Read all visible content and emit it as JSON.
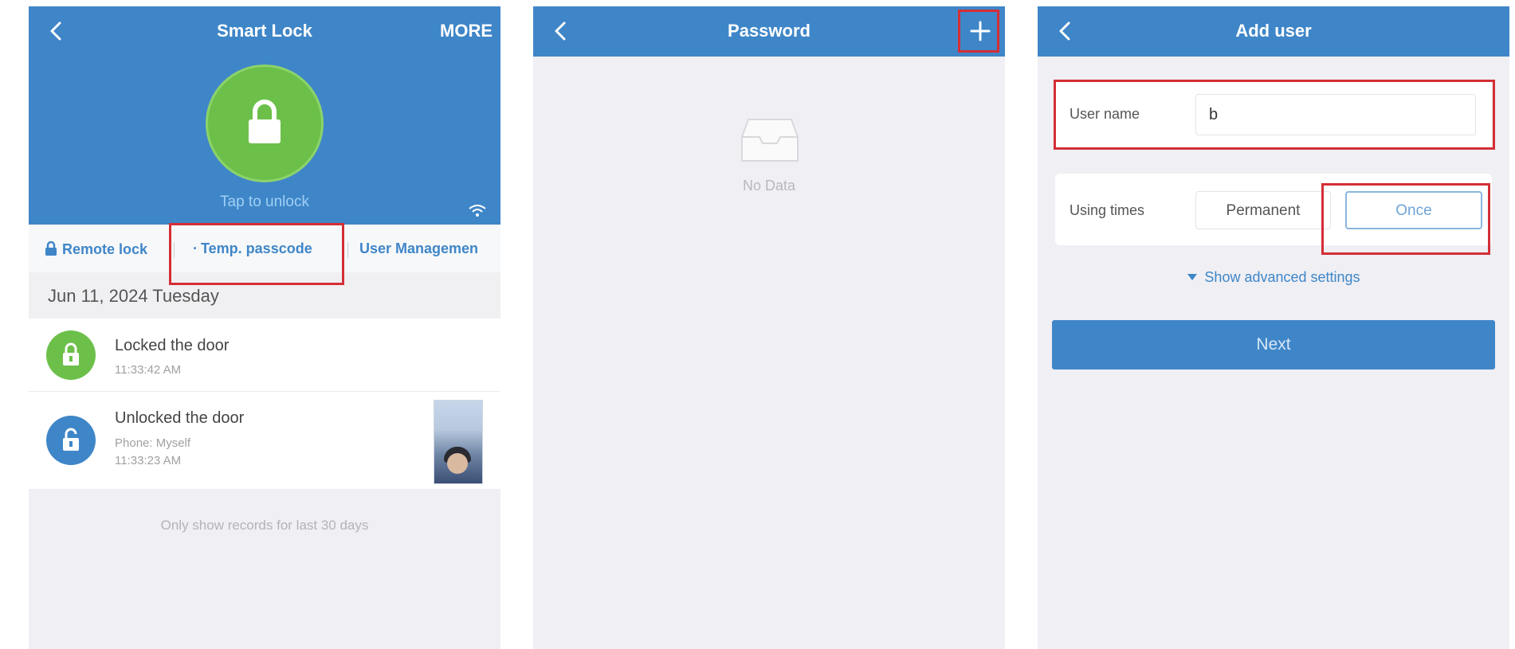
{
  "screens": {
    "smart_lock": {
      "title": "Smart Lock",
      "more_label": "MORE",
      "tap_to_unlock": "Tap to unlock",
      "actions": {
        "remote_lock": "Remote lock",
        "temp_passcode": "Temp. passcode",
        "user_management": "User Managemen"
      },
      "date_header": "Jun 11, 2024 Tuesday",
      "records": [
        {
          "title": "Locked the door",
          "time": "11:33:42 AM",
          "status": "locked",
          "color": "#6cc04a"
        },
        {
          "title": "Unlocked the door",
          "source": "Phone: Myself",
          "time": "11:33:23 AM",
          "status": "unlocked",
          "color": "#3f86c8"
        }
      ],
      "footnote": "Only show records for last 30 days"
    },
    "password": {
      "title": "Password",
      "empty_text": "No Data"
    },
    "add_user": {
      "title": "Add user",
      "username_label": "User name",
      "username_value": "b",
      "using_times_label": "Using times",
      "option_permanent": "Permanent",
      "option_once": "Once",
      "selected_option": "Once",
      "advanced_label": "Show advanced settings",
      "next_label": "Next"
    }
  },
  "colors": {
    "brand_blue": "#3f86c8",
    "lock_green": "#6cc04a",
    "highlight_red": "#d42e36",
    "background": "#efeff4"
  }
}
